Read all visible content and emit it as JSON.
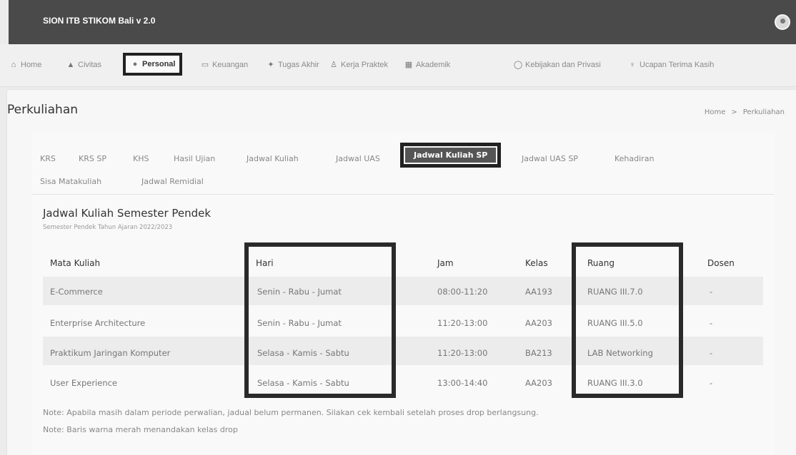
{
  "app": {
    "title": "SION ITB STIKOM Bali  v 2.0"
  },
  "nav": {
    "items": [
      {
        "label": "Home",
        "icon": "home-icon"
      },
      {
        "label": "Civitas",
        "icon": "graduation-cap-icon"
      },
      {
        "label": "Personal",
        "icon": "user-icon"
      },
      {
        "label": "Keuangan",
        "icon": "money-icon"
      },
      {
        "label": "Tugas Akhir",
        "icon": "sparkle-icon"
      },
      {
        "label": "Kerja Praktek",
        "icon": "worker-icon"
      },
      {
        "label": "Akademik",
        "icon": "book-icon"
      },
      {
        "label": "Kebijakan dan Privasi",
        "icon": "shield-icon"
      },
      {
        "label": "Ucapan Terima Kasih",
        "icon": "thanks-icon"
      }
    ],
    "active": "Personal"
  },
  "page": {
    "title": "Perkuliahan",
    "breadcrumb": [
      "Home",
      "Perkuliahan"
    ],
    "breadcrumb_sep": ">"
  },
  "tabs": {
    "row1": [
      "KRS",
      "KRS SP",
      "KHS",
      "Hasil Ujian",
      "Jadwal Kuliah",
      "Jadwal UAS",
      "Jadwal Kuliah SP",
      "Jadwal UAS SP",
      "Kehadiran"
    ],
    "row2": [
      "Sisa Matakuliah",
      "Jadwal Remidial"
    ],
    "active": "Jadwal Kuliah SP"
  },
  "section": {
    "title": "Jadwal Kuliah Semester Pendek",
    "subtitle": "Semester Pendek Tahun Ajaran 2022/2023"
  },
  "table": {
    "headers": [
      "Mata Kuliah",
      "Hari",
      "Jam",
      "Kelas",
      "Ruang",
      "Dosen"
    ],
    "rows": [
      [
        "E-Commerce",
        "Senin - Rabu - Jumat",
        "08:00-11:20",
        "AA193",
        "RUANG III.7.0",
        "-"
      ],
      [
        "Enterprise Architecture",
        "Senin - Rabu - Jumat",
        "11:20-13:00",
        "AA203",
        "RUANG III.5.0",
        "-"
      ],
      [
        "Praktikum Jaringan Komputer",
        "Selasa - Kamis - Sabtu",
        "11:20-13:00",
        "BA213",
        "LAB Networking",
        "-"
      ],
      [
        "User Experience",
        "Selasa - Kamis - Sabtu",
        "13:00-14:40",
        "AA203",
        "RUANG III.3.0",
        "-"
      ]
    ]
  },
  "notes": [
    "Note: Apabila masih dalam periode perwalian, jadual belum permanen. Silakan cek kembali setelah proses drop berlangsung.",
    "Note: Baris warna merah menandakan kelas drop"
  ],
  "colors": {
    "topbar": "#4a4a4a",
    "highlight": "#2a2a2a",
    "active_tab": "#555555"
  }
}
